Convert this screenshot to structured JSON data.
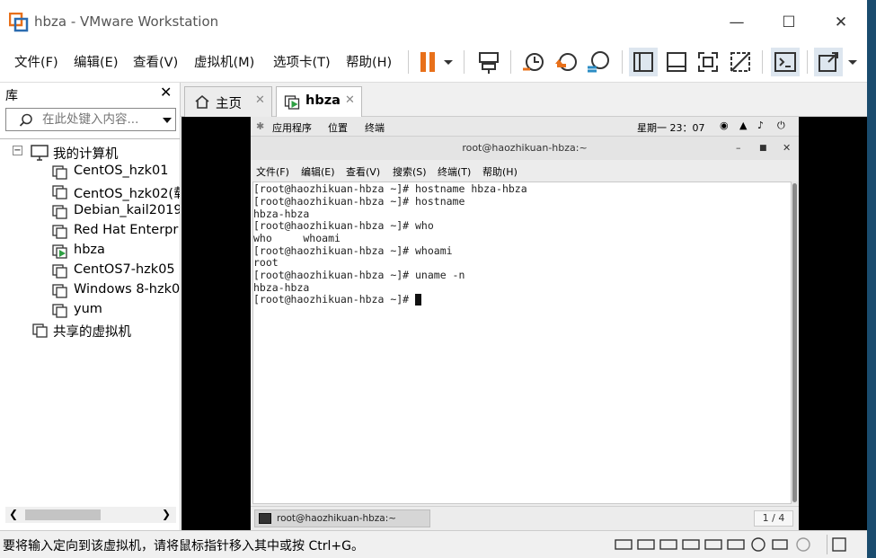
{
  "window": {
    "title": "hbza - VMware Workstation"
  },
  "menu": [
    "文件(F)",
    "编辑(E)",
    "查看(V)",
    "虚拟机(M)",
    "选项卡(T)",
    "帮助(H)"
  ],
  "library": {
    "title": "库",
    "search_placeholder": "在此处键入内容...",
    "root": "我的计算机",
    "vms": [
      "CentOS_hzk01",
      "CentOS_hzk02(载",
      "Debian_kail2019",
      "Red Hat Enterpr",
      "hbza",
      "CentOS7-hzk05",
      "Windows 8-hzk0",
      "yum"
    ],
    "shared": "共享的虚拟机"
  },
  "tabs": [
    {
      "label": "主页"
    },
    {
      "label": "hbza"
    }
  ],
  "guest": {
    "apps": "应用程序",
    "places": "位置",
    "terminal_label": "终端",
    "clock": "星期一 23：07",
    "window_title": "root@haozhikuan-hbza:~",
    "menu": [
      "文件(F)",
      "编辑(E)",
      "查看(V)",
      "搜索(S)",
      "终端(T)",
      "帮助(H)"
    ],
    "lines": [
      "[root@haozhikuan-hbza ~]# hostname hbza-hbza",
      "[root@haozhikuan-hbza ~]# hostname",
      "hbza-hbza",
      "[root@haozhikuan-hbza ~]# who",
      "who     whoami",
      "[root@haozhikuan-hbza ~]# whoami",
      "root",
      "[root@haozhikuan-hbza ~]# uname -n",
      "hbza-hbza",
      "[root@haozhikuan-hbza ~]# "
    ],
    "taskbar_item": "root@haozhikuan-hbza:~",
    "workspace": "1 / 4"
  },
  "status": {
    "text": "要将输入定向到该虚拟机，请将鼠标指针移入其中或按 Ctrl+G。"
  },
  "colors": {
    "accent": "#e8701a",
    "stage": "#000000"
  }
}
